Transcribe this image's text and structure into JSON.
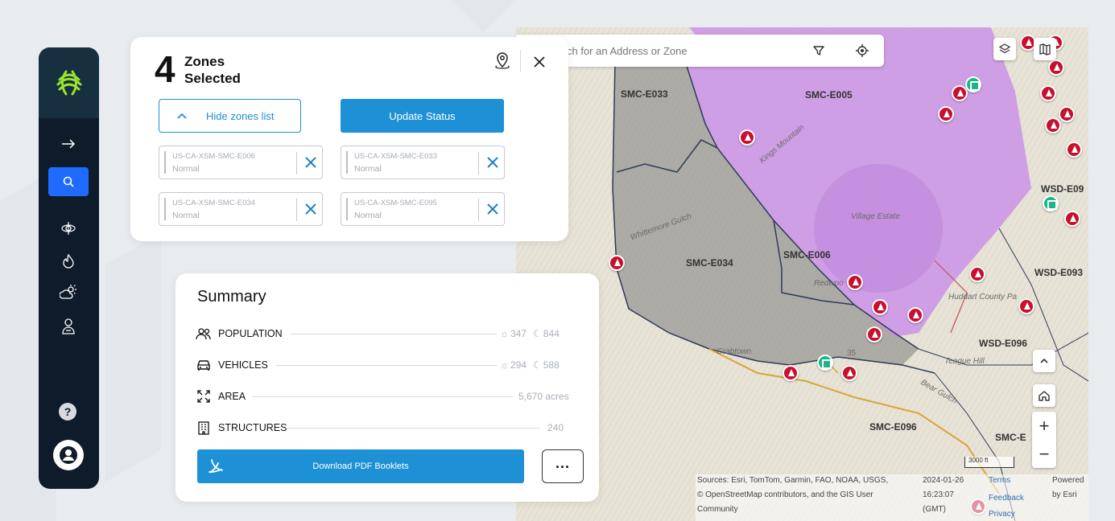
{
  "zones_panel": {
    "count": "4",
    "title_line1": "Zones",
    "title_line2": "Selected",
    "hide_list_label": "Hide zones list",
    "update_status_label": "Update Status",
    "chips": [
      {
        "id": "US-CA-XSM-SMC-E006",
        "status": "Normal"
      },
      {
        "id": "US-CA-XSM-SMC-E033",
        "status": "Normal"
      },
      {
        "id": "US-CA-XSM-SMC-E034",
        "status": "Normal"
      },
      {
        "id": "US-CA-XSM-SMC-E095",
        "status": "Normal"
      }
    ]
  },
  "summary": {
    "title": "Summary",
    "rows": [
      {
        "label": "POPULATION",
        "day": "347",
        "night": "844",
        "icon": "people-icon"
      },
      {
        "label": "VEHICLES",
        "day": "294",
        "night": "588",
        "icon": "car-icon"
      },
      {
        "label": "AREA",
        "value": "5,670 acres",
        "icon": "expand-icon"
      },
      {
        "label": "STRUCTURES",
        "value": "240",
        "icon": "building-icon"
      }
    ],
    "pdf_label": "Download PDF Booklets",
    "more_label": "..."
  },
  "map": {
    "search_placeholder": "ch for an Address or Zone",
    "zone_labels": [
      "SMC-E033",
      "SMC-E005",
      "SMC-E034",
      "SMC-E006",
      "WSD-E09",
      "WSD-E093",
      "WSD-E096",
      "SMC-E096",
      "SMC-E"
    ],
    "place_labels": [
      "Kings Mountain",
      "Whittemore Gulch",
      "Redwoo",
      "Grabtown",
      "Village Estate",
      "Huddart County Pa",
      "35",
      "Teague Hill",
      "Bear Gulch"
    ],
    "scale": "3000 ft",
    "attribution": {
      "sources": "Sources: Esri, TomTom, Garmin, FAO, NOAA, USGS,",
      "osm": "© OpenStreetMap contributors, and the GIS User",
      "community": "Community",
      "date": "2024-01-26",
      "time": "16:23:07",
      "tz": "(GMT)",
      "terms": "Terms",
      "feedback": "Feedback",
      "privacy": "Privacy",
      "powered": "Powered",
      "by": "by Esri"
    },
    "colors": {
      "selected_zone": "#c98de8",
      "gray_zone": "#8a8a8a",
      "pin": "#c8102e",
      "pin_green": "#1cb58a"
    }
  },
  "sidebar": {
    "items": [
      "arrow-right-icon",
      "search-icon",
      "globe-icon",
      "flame-icon",
      "weather-icon",
      "people-icon"
    ],
    "help_label": "?"
  },
  "colors": {
    "accent": "#1e90d6",
    "sidebar": "#0d1b2a",
    "active_nav": "#1f6bff"
  }
}
